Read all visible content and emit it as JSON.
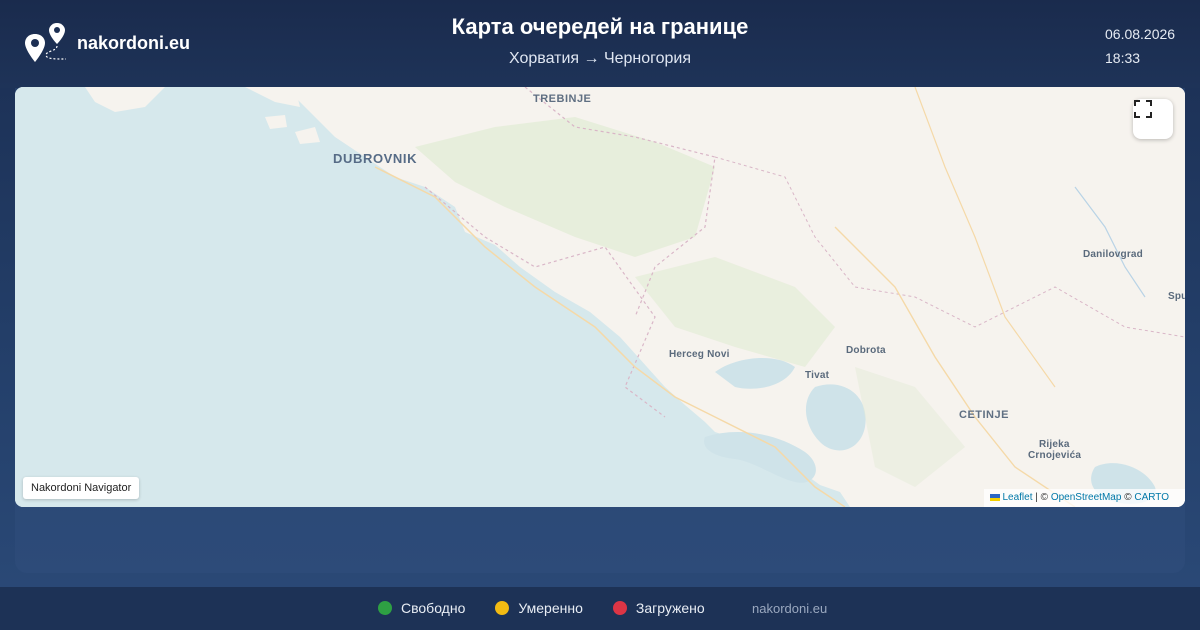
{
  "brand": {
    "name": "nakordoni.eu",
    "logo_icon": "map-pin-route-icon"
  },
  "header": {
    "title": "Карта очередей на границе",
    "route": "Хорватия → Черногория",
    "date": "06.08.2026",
    "time": "18:33"
  },
  "map": {
    "places": {
      "trebinje": "TREBINJE",
      "dubrovnik": "DUBROVNIK",
      "danilovgrad": "Danilovgrad",
      "spuz": "Spu",
      "herceg_novi": "Herceg Novi",
      "dobrota": "Dobrota",
      "tivat": "Tivat",
      "cetinje": "CETINJE",
      "rijeka_1": "Rijeka",
      "rijeka_2": "Crnojevića"
    },
    "fullscreen_icon": "fullscreen-icon",
    "navigator_label": "Nakordoni Navigator",
    "attribution": {
      "leaflet": "Leaflet",
      "sep1": " | © ",
      "osm": "OpenStreetMap",
      "sep2": " © ",
      "carto": "CARTO"
    },
    "colors": {
      "sea": "#d6e8ec",
      "land": "#f6f3ee",
      "vegetation": "#e4ecd7"
    }
  },
  "legend": {
    "items": [
      {
        "label": "Свободно",
        "color": "#2ea043"
      },
      {
        "label": "Умеренно",
        "color": "#f2bb13"
      },
      {
        "label": "Загружено",
        "color": "#dc3545"
      }
    ],
    "site": "nakordoni.eu"
  }
}
